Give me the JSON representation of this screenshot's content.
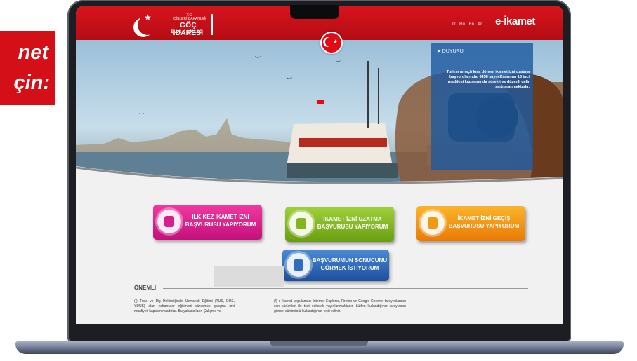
{
  "promo": {
    "line1": "net",
    "line2": "çin:"
  },
  "header": {
    "logo_tc": "T.C.",
    "logo_ministry": "İÇİŞLERİ BAKANLIĞI",
    "logo_main": "GÖÇ İDARESİ",
    "logo_sub": "BAŞKANLIĞI",
    "languages": [
      "Tr",
      "Ru",
      "En",
      "Ar"
    ],
    "eikamet_e": "e",
    "eikamet_dash": "-",
    "eikamet_rest": "İkamet"
  },
  "announcement": {
    "title": "➤ DUYURU",
    "text": "Turizm amaçlı kısa dönem ikamet izni uzatma başvurularında, 6458 sayılı Kanunun 15 inci maddesi kapsamında sürekli ve düzenli gelir şartı aranmaktadır."
  },
  "buttons": {
    "first_application": "İLK KEZ İKAMET İZNİ BAŞVURUSU YAPIYORUM",
    "extension": "İKAMET İZNİ UZATMA BAŞVURUSU YAPIYORUM",
    "transfer": "İKAMET İZNİ GEÇİŞ BAŞVURUSU YAPIYORUM",
    "result": "BAŞVURUMUN SONUCUNU GÖRMEK İSTİYORUM"
  },
  "important": {
    "title": "ÖNEMLİ",
    "col1": "(!) Tıpta ve Diş Hekimliğinde Uzmanlık Eğitimi (TUS, DUS, YDUS) alan yabancılar eğitimleri süresince çalışma izni muafiyeti kapsamındadırlar. Bu yabancıların Çalışma ve",
    "col2": "(!) e-İkamet uygulaması Internet Explorer, Firefox ve Google Chrome tarayıcılarının son sürümleri ile test edilerek yayınlanmaktadır. Lütfen kullandığınız tarayıcının güncel sürümünü kullandığınızı teyit ediniz."
  },
  "colors": {
    "header_red": "#d8141c",
    "pink": "#e0258f",
    "green": "#86b921",
    "orange": "#f39a14",
    "blue": "#2f6bbf"
  }
}
